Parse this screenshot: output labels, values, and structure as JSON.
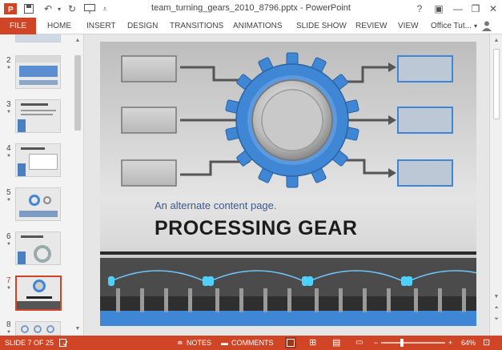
{
  "titlebar": {
    "title": "team_turning_gears_2010_8796.pptx - PowerPoint",
    "icons": [
      "powerpoint-logo-icon",
      "save-icon",
      "undo-icon",
      "redo-icon",
      "start-from-beginning-icon",
      "customize-qat-icon"
    ],
    "help": "?",
    "ribbon_display": "▣",
    "minimize": "—",
    "restore": "❐",
    "close": "✕"
  },
  "ribbon": {
    "file": "FILE",
    "tabs": [
      "HOME",
      "INSERT",
      "DESIGN",
      "TRANSITIONS",
      "ANIMATIONS",
      "SLIDE SHOW",
      "REVIEW",
      "VIEW"
    ],
    "account": "Office Tut...",
    "accent": "#d04525"
  },
  "thumbnails": [
    {
      "num": "2",
      "star": "*"
    },
    {
      "num": "3",
      "star": "*"
    },
    {
      "num": "4",
      "star": "*"
    },
    {
      "num": "5",
      "star": "*"
    },
    {
      "num": "6",
      "star": "*"
    },
    {
      "num": "7",
      "star": "*"
    },
    {
      "num": "8",
      "star": "*"
    }
  ],
  "active_slide": "7",
  "slide": {
    "subtitle": "An alternate content page.",
    "heading": "PROCESSING GEAR",
    "gear_color": "#3f86d4"
  },
  "statusbar": {
    "slide_info": "SLIDE 7 OF 25",
    "notes": "NOTES",
    "comments": "COMMENTS",
    "zoom_minus": "−",
    "zoom_plus": "+",
    "zoom": "64%",
    "zoom_level": 0.64
  }
}
